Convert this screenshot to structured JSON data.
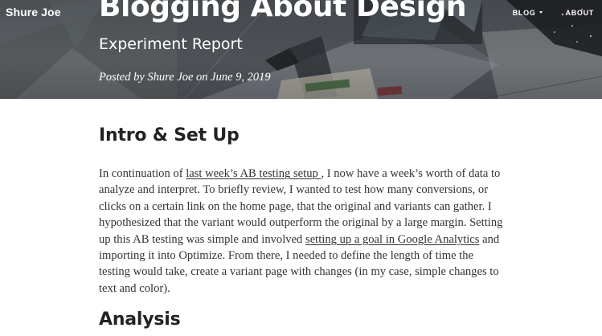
{
  "header": {
    "brand": "Shure Joe",
    "nav": [
      {
        "label": "BLOG",
        "has_dropdown": true
      },
      {
        "label": "ABOUT",
        "has_dropdown": false
      }
    ],
    "title": "Blogging About Design",
    "subtitle": "Experiment Report",
    "meta": "Posted by Shure Joe on June 9, 2019"
  },
  "article": {
    "intro_heading": "Intro & Set Up",
    "intro": {
      "t1": "In continuation of ",
      "link1": "last week’s AB testing setup ",
      "t2": ", I now have a week’s worth of data to analyze and interpret. To briefly review, I wanted to test how many conversions, or clicks on a certain link on the home page, that the original and variants can gather. I hypothesized that the variant would outperform the original by a large margin. Setting up this AB testing was simple and involved ",
      "link2": "setting up a goal in Google Analytics",
      "t3": " and importing it into Optimize. From there, I needed to define the length of time the testing would take, create a variant page with changes (in my case, simple changes to text and color)."
    },
    "analysis_heading": "Analysis"
  },
  "colors": {
    "hero_overlay": "#4c5256",
    "heading_text": "#222222",
    "body_text": "#333333",
    "background": "#ffffff"
  }
}
